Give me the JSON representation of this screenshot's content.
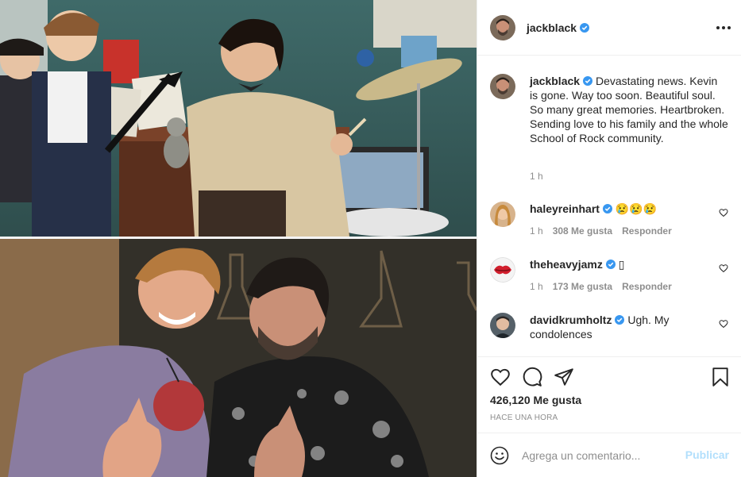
{
  "post": {
    "author": "jackblack",
    "caption": "Devastating news. Kevin is gone. Way too soon. Beautiful soul. So many great memories. Heartbroken. Sending love to his family and the whole School of Rock community.",
    "caption_time": "1 h"
  },
  "comments": [
    {
      "username": "haleyreinhart",
      "text": "😢😢😢",
      "time": "1 h",
      "likes": "308 Me gusta",
      "reply": "Responder"
    },
    {
      "username": "theheavyjamz",
      "text": "▯",
      "time": "1 h",
      "likes": "173 Me gusta",
      "reply": "Responder"
    },
    {
      "username": "davidkrumholtz",
      "text": "Ugh. My condolences",
      "time": "",
      "likes": "",
      "reply": ""
    }
  ],
  "stats": {
    "likes": "426,120 Me gusta",
    "posted": "HACE UNA HORA"
  },
  "composer": {
    "placeholder": "Agrega un comentario...",
    "publish": "Publicar"
  },
  "colors": {
    "verified": "#3897f0",
    "publish_disabled": "#b2dffc",
    "secondary_text": "#8e8e8e"
  },
  "icons": {
    "verified": "verified-badge-icon",
    "like": "heart-icon",
    "comment": "comment-icon",
    "share": "paper-plane-icon",
    "save": "bookmark-icon",
    "emoji": "emoji-icon",
    "more": "more-options-icon"
  }
}
